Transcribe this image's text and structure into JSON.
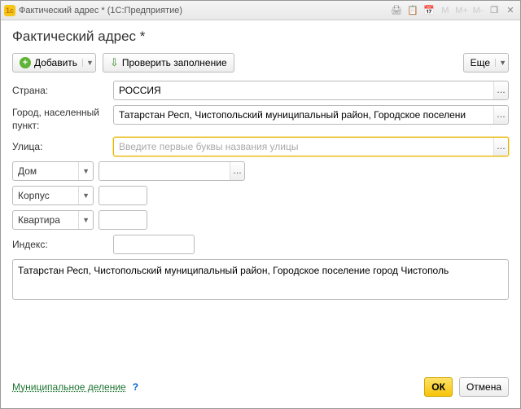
{
  "window": {
    "title": "Фактический адрес *  (1С:Предприятие)"
  },
  "header": {
    "title": "Фактический адрес *"
  },
  "toolbar": {
    "add_label": "Добавить",
    "check_label": "Проверить заполнение",
    "more_label": "Еще"
  },
  "labels": {
    "country": "Страна:",
    "city": "Город, населенный пункт:",
    "street": "Улица:",
    "index": "Индекс:"
  },
  "values": {
    "country": "РОССИЯ",
    "city": "Татарстан Респ, Чистопольский муниципальный район, Городское поселени",
    "street": "",
    "street_placeholder": "Введите первые буквы названия улицы",
    "index": "",
    "full_address": "Татарстан Респ, Чистопольский муниципальный район, Городское поселение город Чистополь"
  },
  "parts": {
    "house_label": "Дом",
    "house_value": "",
    "korpus_label": "Корпус",
    "korpus_value": "",
    "apt_label": "Квартира",
    "apt_value": ""
  },
  "footer": {
    "link": "Муниципальное деление",
    "ok": "ОК",
    "cancel": "Отмена"
  },
  "title_icons": {
    "m": "M",
    "mplus": "M+",
    "mminus": "M-"
  }
}
